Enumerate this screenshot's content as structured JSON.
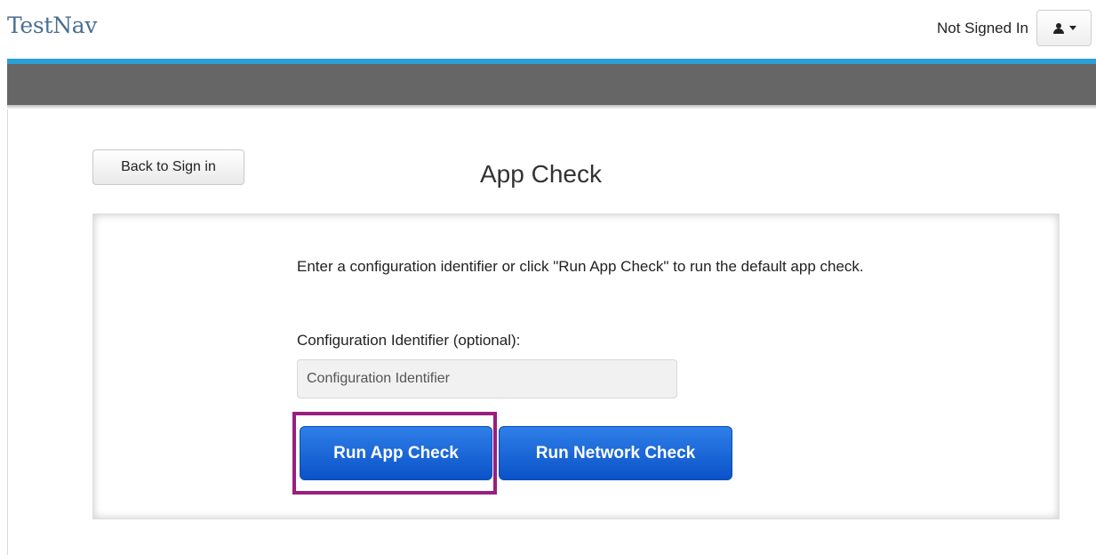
{
  "header": {
    "brand": "TestNav",
    "signin_status": "Not Signed In"
  },
  "page": {
    "back_label": "Back to Sign in",
    "title": "App Check"
  },
  "panel": {
    "instructions": "Enter a configuration identifier or click \"Run App Check\" to run the default app check.",
    "field_label": "Configuration Identifier (optional):",
    "input_placeholder": "Configuration Identifier",
    "input_value": "",
    "run_app_label": "Run App Check",
    "run_network_label": "Run Network Check"
  },
  "icons": {
    "user_menu": "user-icon",
    "dropdown": "caret-down-icon"
  },
  "colors": {
    "brand": "#4a6f93",
    "accent": "#2aa0d6",
    "nav": "#666666",
    "primary_button": "#0a52c8",
    "highlight": "#9a1e7d"
  }
}
